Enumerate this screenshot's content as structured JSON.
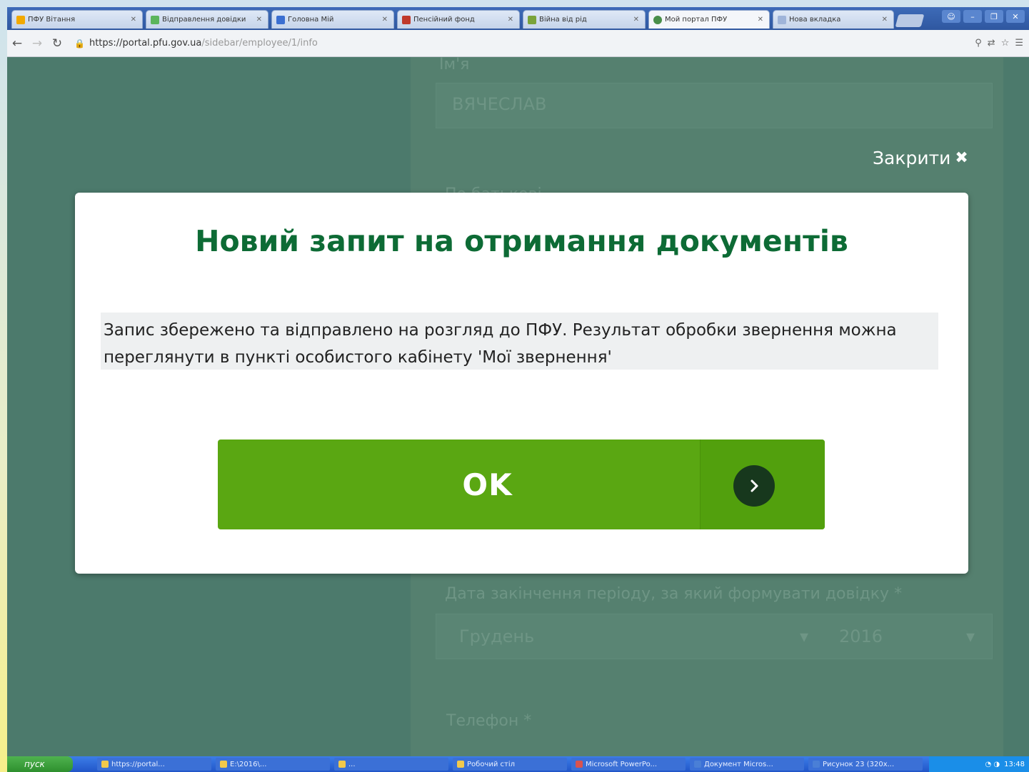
{
  "browser": {
    "tabs": [
      {
        "title": "ПФУ Вiтання",
        "fav_color": "#f2a900"
      },
      {
        "title": "Вiдправлення довiдки",
        "fav_color": "#5bb55b"
      },
      {
        "title": "Головна Мiй",
        "fav_color": "#3b6fd1"
      },
      {
        "title": "Пенсiйний фонд",
        "fav_color": "#c0392b"
      },
      {
        "title": "Вiйна вiд рiд",
        "fav_color": "#7aa33a"
      },
      {
        "title": "Мой портал ПФУ",
        "fav_color": "#4a8f4a"
      },
      {
        "title": "Нова вкладка",
        "fav_color": "#9fb4d9"
      }
    ],
    "url_host": "https://portal.pfu.gov.ua",
    "url_path": "/sidebar/employee/1/info"
  },
  "background_page": {
    "field_name_label": "Iм'я",
    "field_name_value": "ВЯЧЕСЛАВ",
    "field_patronymic_label": "По батьковi",
    "period_end_label": "Дата закiнчення перiоду, за який формувати довiдку *",
    "month_value": "Грудень",
    "year_value": "2016",
    "phone_label": "Телефон *"
  },
  "modal": {
    "close_label": "Закрити",
    "title": "Новий запит на отримання документів",
    "message": "Запис збережено та відправлено на розгляд до ПФУ. Результат обробки звернення можна переглянути в пункті особистого кабінету 'Мої звернення'",
    "ok_label": "OK"
  },
  "taskbar": {
    "start_label": "пуск",
    "items": [
      "https://portal...",
      "E:\\2016\\...",
      "...",
      "Робочий стіл",
      "Microsoft PowerPo...",
      "Документ Micros...",
      "Рисунок 23 (320x..."
    ],
    "clock": "13:48"
  },
  "colors": {
    "overlay": "#4c7a6c",
    "title_green": "#0d6b35",
    "button_green": "#5aa712",
    "button_circle": "#17381d"
  }
}
